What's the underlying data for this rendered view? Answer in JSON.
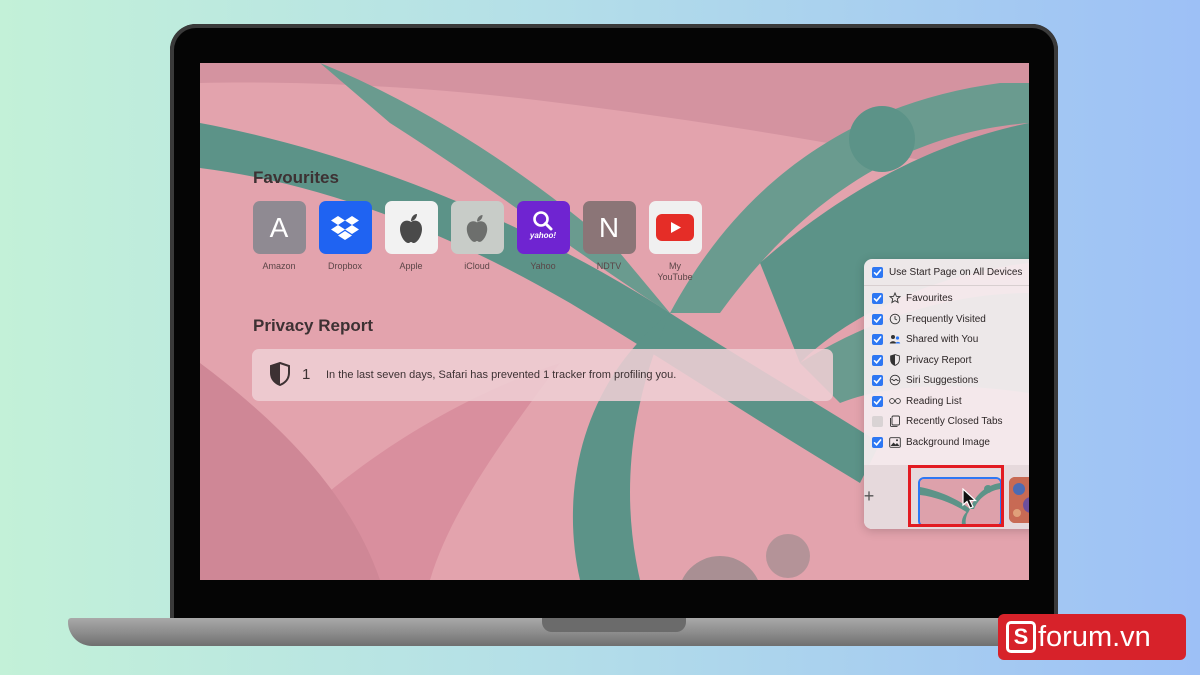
{
  "start_page": {
    "favourites_title": "Favourites",
    "favourites": [
      {
        "label": "Amazon",
        "glyph": "A",
        "icon": "amazon-tile",
        "color": "#8f8a92"
      },
      {
        "label": "Dropbox",
        "glyph": "",
        "icon": "dropbox-logo",
        "color": "#1f63f2"
      },
      {
        "label": "Apple",
        "glyph": "",
        "icon": "apple-logo",
        "color": "#f2f2f2"
      },
      {
        "label": "iCloud",
        "glyph": "",
        "icon": "apple-logo",
        "color": "#c8ccc8"
      },
      {
        "label": "Yahoo",
        "glyph": "",
        "icon": "yahoo-logo",
        "color": "#6f24d1"
      },
      {
        "label": "NDTV",
        "glyph": "N",
        "icon": "ndtv-tile",
        "color": "#8b7577"
      },
      {
        "label": "My\nYouTube",
        "glyph": "",
        "icon": "youtube-logo",
        "color": "#f0f0f0"
      }
    ],
    "yahoo_text": "yahoo!",
    "privacy_title": "Privacy Report",
    "privacy_count": "1",
    "privacy_message": "In the last seven days, Safari has prevented 1 tracker from profiling you."
  },
  "customize_panel": {
    "top_option": {
      "label": "Use Start Page on All Devices",
      "checked": true
    },
    "options": [
      {
        "label": "Favourites",
        "checked": true,
        "icon": "star-icon"
      },
      {
        "label": "Frequently Visited",
        "checked": true,
        "icon": "clock-icon"
      },
      {
        "label": "Shared with You",
        "checked": true,
        "icon": "people-icon"
      },
      {
        "label": "Privacy Report",
        "checked": true,
        "icon": "shield-icon"
      },
      {
        "label": "Siri Suggestions",
        "checked": true,
        "icon": "siri-icon"
      },
      {
        "label": "Reading List",
        "checked": true,
        "icon": "glasses-icon"
      },
      {
        "label": "Recently Closed Tabs",
        "checked": false,
        "icon": "tabs-icon"
      },
      {
        "label": "Background Image",
        "checked": true,
        "icon": "image-icon"
      }
    ],
    "add_label": "+"
  },
  "watermark": {
    "brand_letter": "S",
    "brand_text": "forum.vn"
  },
  "colors": {
    "accent": "#2d77f3",
    "highlight": "#e21b22",
    "brand": "#d7222a"
  }
}
